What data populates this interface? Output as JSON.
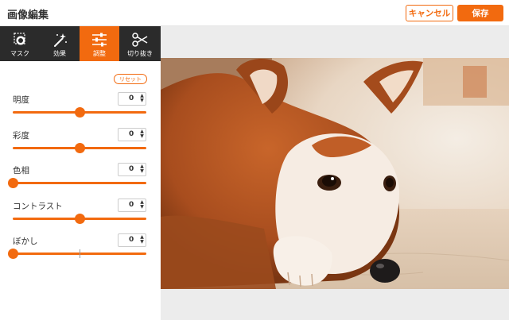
{
  "header": {
    "title": "画像編集",
    "cancel_label": "キャンセル",
    "save_label": "保存"
  },
  "toolbar": {
    "tools": [
      {
        "label": "マスク",
        "icon": "mask-icon",
        "active": false
      },
      {
        "label": "効果",
        "icon": "magic-wand-icon",
        "active": false
      },
      {
        "label": "調整",
        "icon": "sliders-icon",
        "active": true
      },
      {
        "label": "切り抜き",
        "icon": "scissors-icon",
        "active": false
      }
    ]
  },
  "panel": {
    "reset_label": "リセット",
    "adjustments": [
      {
        "label": "明度",
        "value": "0",
        "level": 0.5
      },
      {
        "label": "彩度",
        "value": "0",
        "level": 0.5
      },
      {
        "label": "色相",
        "value": "0",
        "level": 0.0
      },
      {
        "label": "コントラスト",
        "value": "0",
        "level": 0.5
      },
      {
        "label": "ぼかし",
        "value": "0",
        "level": 0.0
      }
    ]
  },
  "canvas": {
    "image": "shiba-inu-dog-photo",
    "background": "#ececec"
  },
  "colors": {
    "accent": "#f26a0f",
    "toolbar_bg": "#2b2b2b"
  }
}
